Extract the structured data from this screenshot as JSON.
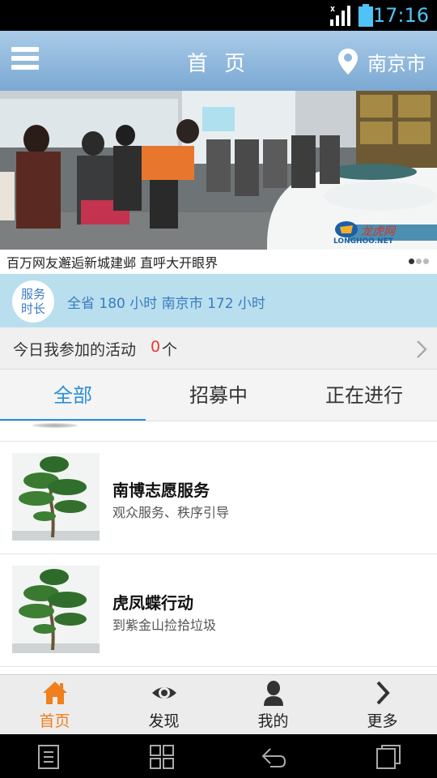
{
  "status_bar": {
    "time": "17:16"
  },
  "header": {
    "title": "首 页",
    "city": "南京市"
  },
  "banner": {
    "caption": "百万网友邂逅新城建邺 直呼大开眼界",
    "watermark": "LONGHOO.NET",
    "page_count": 3,
    "active_index": 0
  },
  "service": {
    "badge_line1": "服务",
    "badge_line2": "时长",
    "text": "全省 180 小时 南京市 172 小时"
  },
  "today": {
    "label": "今日我参加的活动",
    "count": "0",
    "unit": "个"
  },
  "tabs": [
    {
      "label": "全部",
      "active": true
    },
    {
      "label": "招募中",
      "active": false
    },
    {
      "label": "正在进行",
      "active": false
    }
  ],
  "activities": [
    {
      "title": "南博志愿服务",
      "desc": "观众服务、秩序引导"
    },
    {
      "title": "虎凤蝶行动",
      "desc": "到紫金山捡拾垃圾"
    }
  ],
  "bottom_nav": [
    {
      "label": "首页",
      "icon": "home-icon",
      "active": true
    },
    {
      "label": "发现",
      "icon": "eye-icon",
      "active": false
    },
    {
      "label": "我的",
      "icon": "person-icon",
      "active": false
    },
    {
      "label": "更多",
      "icon": "chevron-right-icon",
      "active": false
    }
  ],
  "colors": {
    "accent": "#2b8fd8",
    "active_nav": "#f07f1d",
    "header": "#8fb8dd",
    "service_bg": "#b9dfee",
    "count": "#e53935"
  }
}
